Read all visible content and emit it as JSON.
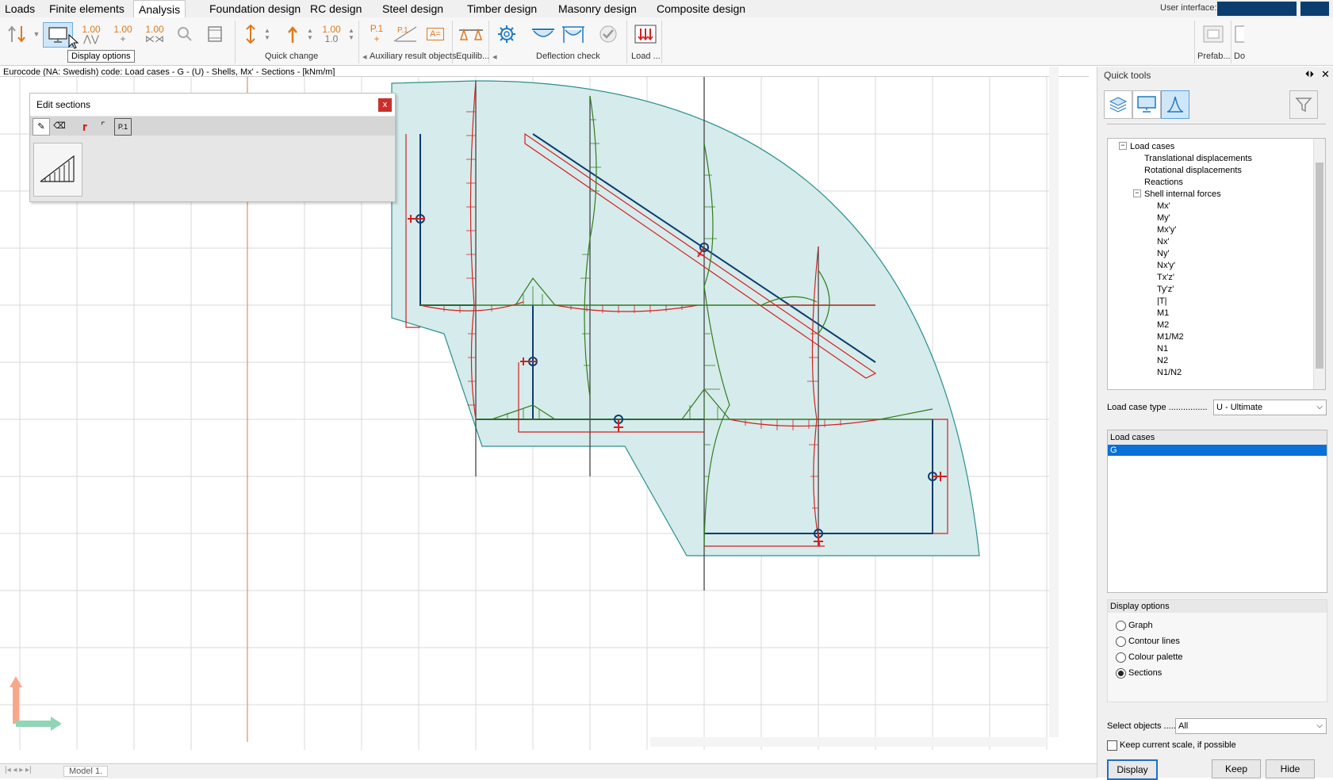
{
  "menu": {
    "tabs": [
      "Loads",
      "Finite elements",
      "Analysis",
      "Foundation design",
      "RC design",
      "Steel design",
      "Timber design",
      "Masonry design",
      "Composite design"
    ],
    "active": "Analysis",
    "user_interface_label": "User interface:"
  },
  "ribbon": {
    "groups": {
      "quick_change": "Quick change",
      "auxiliary": "Auxiliary result objects",
      "equilibrium": "Equilib...",
      "deflection": "Deflection check",
      "load": "Load ...",
      "prefab": "Prefab...",
      "do": "Do"
    },
    "scale_values": [
      "1.00",
      "1.00",
      "1.00",
      "1.00",
      "1.00",
      "1.0"
    ],
    "p1_labels": [
      "P.1",
      "P.1"
    ],
    "a_eq": "A="
  },
  "tooltip": "Display options",
  "status_line": "Eurocode (NA: Swedish) code: Load cases - G - (U) - Shells, Mx' - Sections - [kNm/m]",
  "edit_sections": {
    "title": "Edit sections",
    "close": "x",
    "p1": "P.1"
  },
  "quick_tools": {
    "title": "Quick tools",
    "tree": [
      {
        "label": "Load cases",
        "level": 0,
        "expander": "−"
      },
      {
        "label": "Translational displacements",
        "level": 1
      },
      {
        "label": "Rotational displacements",
        "level": 1
      },
      {
        "label": "Reactions",
        "level": 1
      },
      {
        "label": "Shell internal forces",
        "level": 1,
        "expander": "−"
      },
      {
        "label": "Mx'",
        "level": 2
      },
      {
        "label": "My'",
        "level": 2
      },
      {
        "label": "Mx'y'",
        "level": 2
      },
      {
        "label": "Nx'",
        "level": 2
      },
      {
        "label": "Ny'",
        "level": 2
      },
      {
        "label": "Nx'y'",
        "level": 2
      },
      {
        "label": "Tx'z'",
        "level": 2
      },
      {
        "label": "Ty'z'",
        "level": 2
      },
      {
        "label": "|T|",
        "level": 2
      },
      {
        "label": "M1",
        "level": 2
      },
      {
        "label": "M2",
        "level": 2
      },
      {
        "label": "M1/M2",
        "level": 2
      },
      {
        "label": "N1",
        "level": 2
      },
      {
        "label": "N2",
        "level": 2
      },
      {
        "label": "N1/N2",
        "level": 2
      }
    ],
    "load_case_type_label": "Load case type ................",
    "load_case_type_value": "U - Ultimate",
    "load_cases_header": "Load cases",
    "load_cases": [
      "G"
    ],
    "display_options_header": "Display options",
    "display_options": [
      "Graph",
      "Contour lines",
      "Colour palette",
      "Sections"
    ],
    "display_selected": "Sections",
    "select_objects_label": "Select objects ......",
    "select_objects_value": "All",
    "keep_scale_label": "Keep current scale, if possible",
    "buttons": {
      "display": "Display",
      "keep": "Keep",
      "hide": "Hide"
    }
  },
  "bottom": {
    "model_tab": "Model 1."
  },
  "colors": {
    "accent": "#1f7ac0",
    "plate_fill": "#d6ebeb",
    "plate_stroke": "#2b8f8f",
    "pos_diagram": "#2f7d1f",
    "neg_diagram": "#d32020"
  }
}
